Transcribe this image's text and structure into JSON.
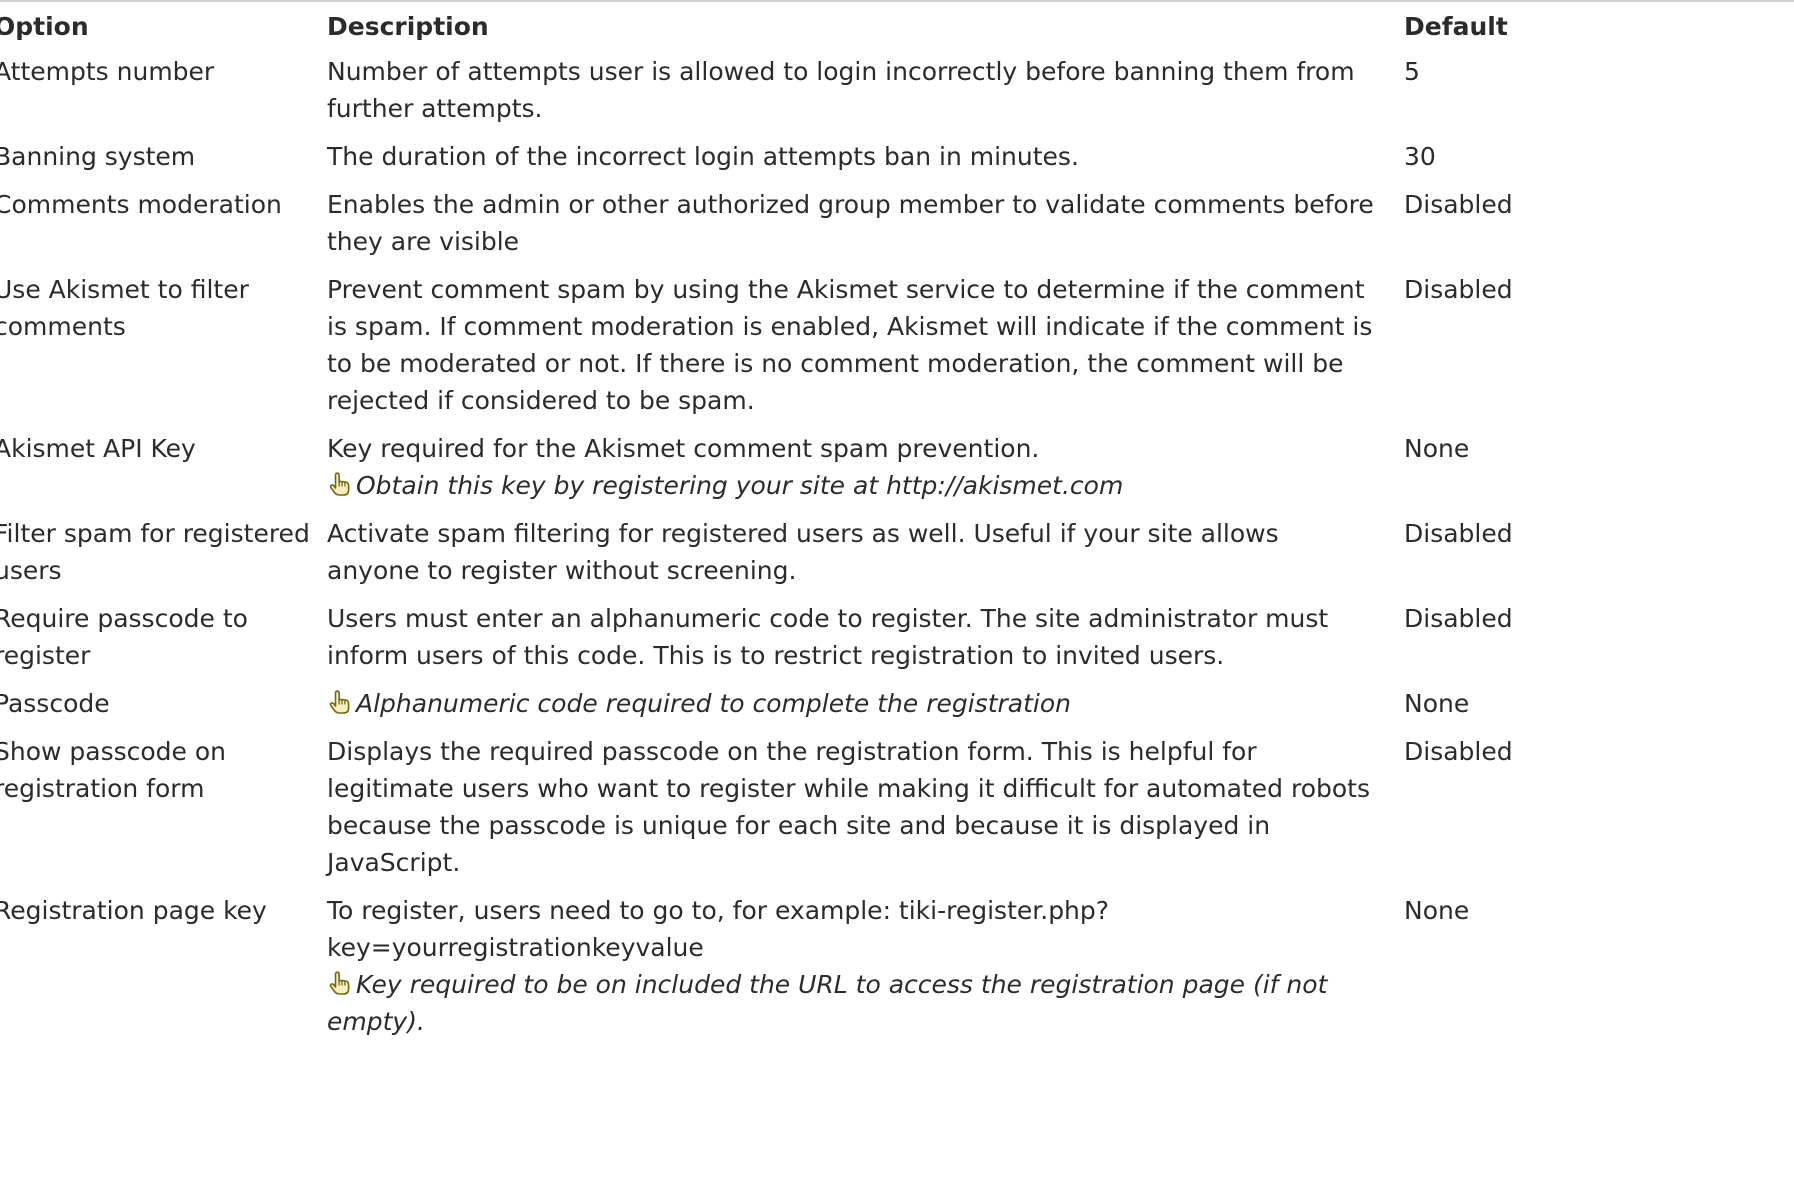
{
  "table": {
    "headers": {
      "option": "Option",
      "description": "Description",
      "default": "Default"
    },
    "icon": "pointing-hand-icon",
    "rows": [
      {
        "option": "Attempts number",
        "description": "Number of attempts user is allowed to login incorrectly before banning them from further attempts.",
        "tip": "",
        "default": "5"
      },
      {
        "option": "Banning system",
        "description": "The duration of the incorrect login attempts ban in minutes.",
        "tip": "",
        "default": "30"
      },
      {
        "option": "Comments moderation",
        "description": "Enables the admin or other authorized group member to validate comments before they are visible",
        "tip": "",
        "default": "Disabled"
      },
      {
        "option": "Use Akismet to filter comments",
        "description": "Prevent comment spam by using the Akismet service to determine if the comment is spam. If comment moderation is enabled, Akismet will indicate if the comment is to be moderated or not. If there is no comment moderation, the comment will be rejected if considered to be spam.",
        "tip": "",
        "default": "Disabled"
      },
      {
        "option": "Akismet API Key",
        "description": "Key required for the Akismet comment spam prevention.",
        "tip": "Obtain this key by registering your site at http://akismet.com",
        "default": "None"
      },
      {
        "option": "Filter spam for registered users",
        "description": "Activate spam filtering for registered users as well. Useful if your site allows anyone to register without screening.",
        "tip": "",
        "default": "Disabled"
      },
      {
        "option": "Require passcode to register",
        "description": "Users must enter an alphanumeric code to register. The site administrator must inform users of this code. This is to restrict registration to invited users.",
        "tip": "",
        "default": "Disabled"
      },
      {
        "option": "Passcode",
        "description": "",
        "tip": "Alphanumeric code required to complete the registration",
        "default": "None"
      },
      {
        "option": "Show passcode on registration form",
        "description": "Displays the required passcode on the registration form. This is helpful for legitimate users who want to register while making it difficult for automated robots because the passcode is unique for each site and because it is displayed in JavaScript.",
        "tip": "",
        "default": "Disabled"
      },
      {
        "option": "Registration page key",
        "description": "To register, users need to go to, for example: tiki-register.php?key=yourregistrationkeyvalue",
        "tip": "Key required to be on included the URL to access the registration page (if not empty).",
        "default": "None"
      }
    ]
  }
}
